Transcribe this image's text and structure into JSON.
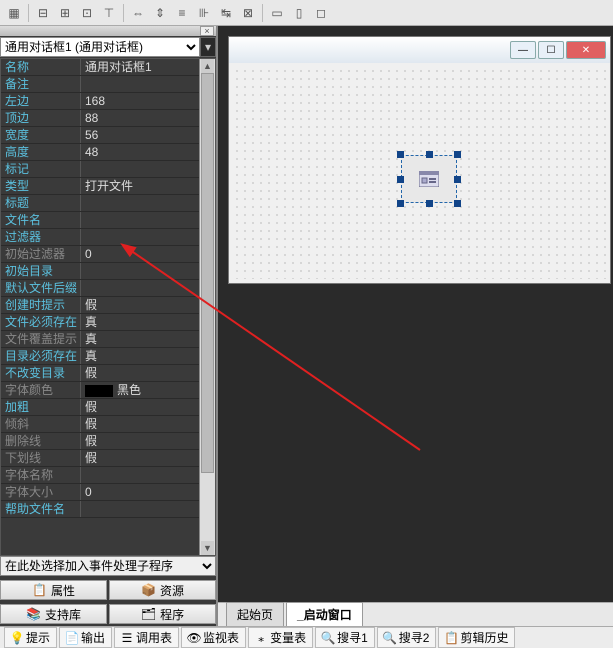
{
  "combo": {
    "selected": "通用对话框1 (通用对话框)"
  },
  "props": [
    {
      "label": "名称",
      "value": "通用对话框1"
    },
    {
      "label": "备注",
      "value": ""
    },
    {
      "label": "左边",
      "value": "168"
    },
    {
      "label": "顶边",
      "value": "88"
    },
    {
      "label": "宽度",
      "value": "56"
    },
    {
      "label": "高度",
      "value": "48"
    },
    {
      "label": "标记",
      "value": ""
    },
    {
      "label": "类型",
      "value": "打开文件"
    },
    {
      "label": "标题",
      "value": ""
    },
    {
      "label": "文件名",
      "value": ""
    },
    {
      "label": "过滤器",
      "value": ""
    },
    {
      "label": "初始过滤器",
      "value": "0",
      "muted": true
    },
    {
      "label": "初始目录",
      "value": ""
    },
    {
      "label": "默认文件后缀",
      "value": ""
    },
    {
      "label": "创建时提示",
      "value": "假"
    },
    {
      "label": "文件必须存在",
      "value": "真"
    },
    {
      "label": "文件覆盖提示",
      "value": "真",
      "muted": true
    },
    {
      "label": "目录必须存在",
      "value": "真"
    },
    {
      "label": "不改变目录",
      "value": "假"
    },
    {
      "label": "字体颜色",
      "value": "黑色",
      "muted": true,
      "swatch": true
    },
    {
      "label": "加粗",
      "value": "假"
    },
    {
      "label": "倾斜",
      "value": "假",
      "muted": true
    },
    {
      "label": "删除线",
      "value": "假",
      "muted": true
    },
    {
      "label": "下划线",
      "value": "假",
      "muted": true
    },
    {
      "label": "字体名称",
      "value": "",
      "muted": true
    },
    {
      "label": "字体大小",
      "value": "0",
      "muted": true
    },
    {
      "label": "帮助文件名",
      "value": ""
    }
  ],
  "event_combo": "在此处选择加入事件处理子程序",
  "btns": {
    "prop": "属性",
    "res": "资源",
    "lib": "支持库",
    "prog": "程序"
  },
  "tabs": {
    "start": "起始页",
    "window": "_启动窗口"
  },
  "bottom": {
    "tip": "提示",
    "output": "输出",
    "calls": "调用表",
    "watch": "监视表",
    "vars": "变量表",
    "find1": "搜寻1",
    "find2": "搜寻2",
    "clip": "剪辑历史"
  }
}
